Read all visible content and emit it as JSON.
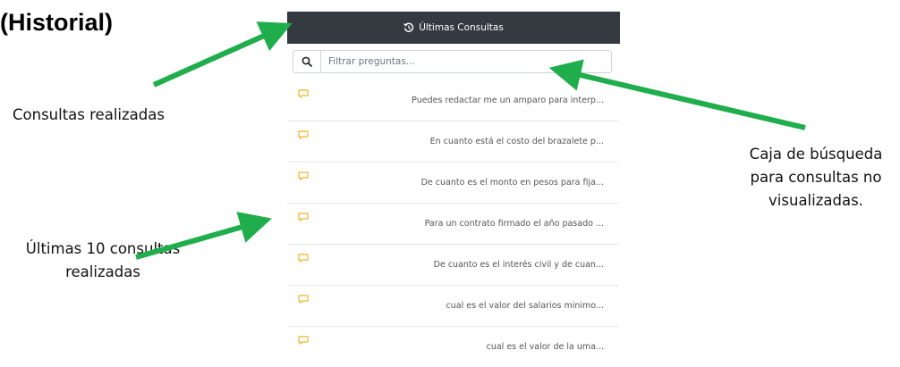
{
  "annotations": {
    "title": "(Historial)",
    "consultas_realizadas": "Consultas realizadas",
    "ultimas_line1": "Últimas 10 consultas",
    "ultimas_line2": "realizadas",
    "caja_line1": "Caja de búsqueda",
    "caja_line2": "para consultas no",
    "caja_line3": "visualizadas."
  },
  "panel": {
    "header_title": "Últimas Consultas",
    "header_icon": "history-icon",
    "search_icon": "search-icon",
    "search_placeholder": "Filtrar preguntas...",
    "item_icon": "chat-bubble-icon",
    "items": [
      "Puedes redactar me un amparo para interp...",
      "En cuanto está el costo del brazalete p...",
      "De cuanto es el monto en pesos para fija...",
      "Para un contrato firmado el año pasado ...",
      "De cuanto es el interés civil y de cuan...",
      "cual es el valor del salarios minimo...",
      "cual es el valor de la uma..."
    ]
  },
  "colors": {
    "header_bg": "#343a40",
    "arrow": "#1fae4b",
    "chat_icon": "#f0b429"
  }
}
